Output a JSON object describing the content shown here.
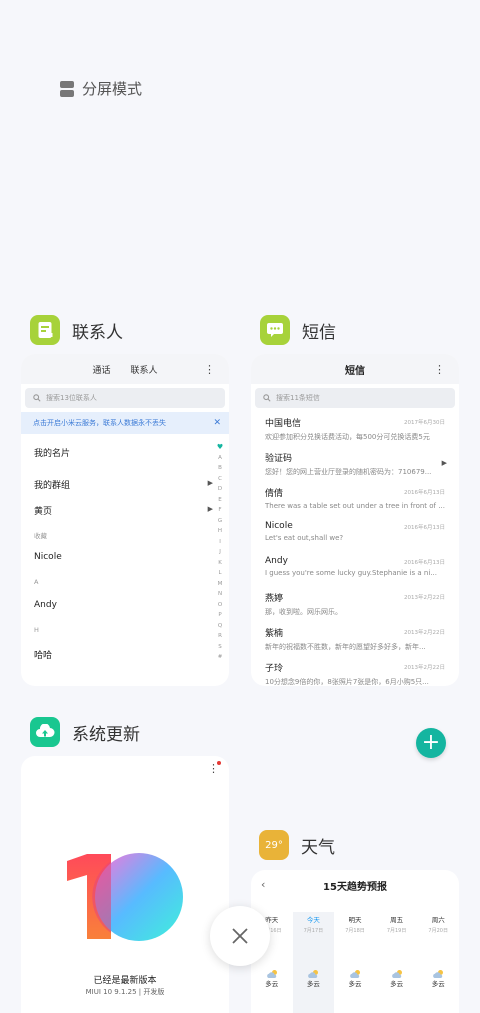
{
  "split_screen": {
    "label": "分屏模式"
  },
  "contacts_app": {
    "title": "联系人",
    "tabs": [
      "通话",
      "联系人"
    ],
    "search_placeholder": "搜索13位联系人",
    "banner": "点击开启小米云服务，联系人数据永不丢失",
    "rows": {
      "my_card": "我的名片",
      "my_groups": "我的群组",
      "yellow_pages": "黄页",
      "favorites_section": "收藏",
      "nicole": "Nicole",
      "section_a": "A",
      "andy": "Andy",
      "section_h": "H",
      "haha": "哈哈"
    },
    "alphabet": [
      "A",
      "B",
      "C",
      "D",
      "E",
      "F",
      "G",
      "H",
      "I",
      "J",
      "K",
      "L",
      "M",
      "N",
      "O",
      "P",
      "Q",
      "R",
      "S",
      "#"
    ]
  },
  "messages_app": {
    "title": "短信",
    "header": "短信",
    "search_placeholder": "搜索11条短信",
    "items": [
      {
        "name": "中国电信",
        "date": "2017年6月30日",
        "preview": "欢迎参加积分兑换话费活动，每500分可兑换话费5元"
      },
      {
        "name": "验证码",
        "date": "",
        "preview": "您好！您的网上营业厅登录的随机密码为：710679..."
      },
      {
        "name": "倩倩",
        "date": "2016年6月13日",
        "preview": "There was a table set out under a tree in front of ..."
      },
      {
        "name": "Nicole",
        "date": "2016年6月13日",
        "preview": "Let's eat out,shall we?"
      },
      {
        "name": "Andy",
        "date": "2016年6月13日",
        "preview": "I guess you're some lucky guy.Stephanie is a ni..."
      },
      {
        "name": "燕婷",
        "date": "2013年2月22日",
        "preview": "那，收到啦。网乐网乐。"
      },
      {
        "name": "紫楠",
        "date": "2013年2月22日",
        "preview": "新年的祝福数不胜数，新年的愿望好多好多，新年..."
      },
      {
        "name": "子玲",
        "date": "2013年2月22日",
        "preview": "10分想念9倍的你，8张照片7张是你，6月小购5只..."
      }
    ]
  },
  "update_app": {
    "title": "系统更新",
    "status": "已经是最新版本",
    "version": "MIUI 10 9.1.25 | 开发版"
  },
  "weather_app": {
    "title": "天气",
    "temperature": "29°",
    "header": "15天趋势预报",
    "days": [
      {
        "name": "昨天",
        "date": "7月16日",
        "cond": "多云"
      },
      {
        "name": "今天",
        "date": "7月17日",
        "cond": "多云"
      },
      {
        "name": "明天",
        "date": "7月18日",
        "cond": "多云"
      },
      {
        "name": "周五",
        "date": "7月19日",
        "cond": "多云"
      },
      {
        "name": "周六",
        "date": "7月20日",
        "cond": "多云"
      }
    ]
  },
  "colors": {
    "accent": "#14b5a0",
    "contacts_icon": "#a7d23a",
    "update_icon": "#19c790",
    "weather_icon": "#e9b338",
    "link_blue": "#3b7ad6"
  }
}
